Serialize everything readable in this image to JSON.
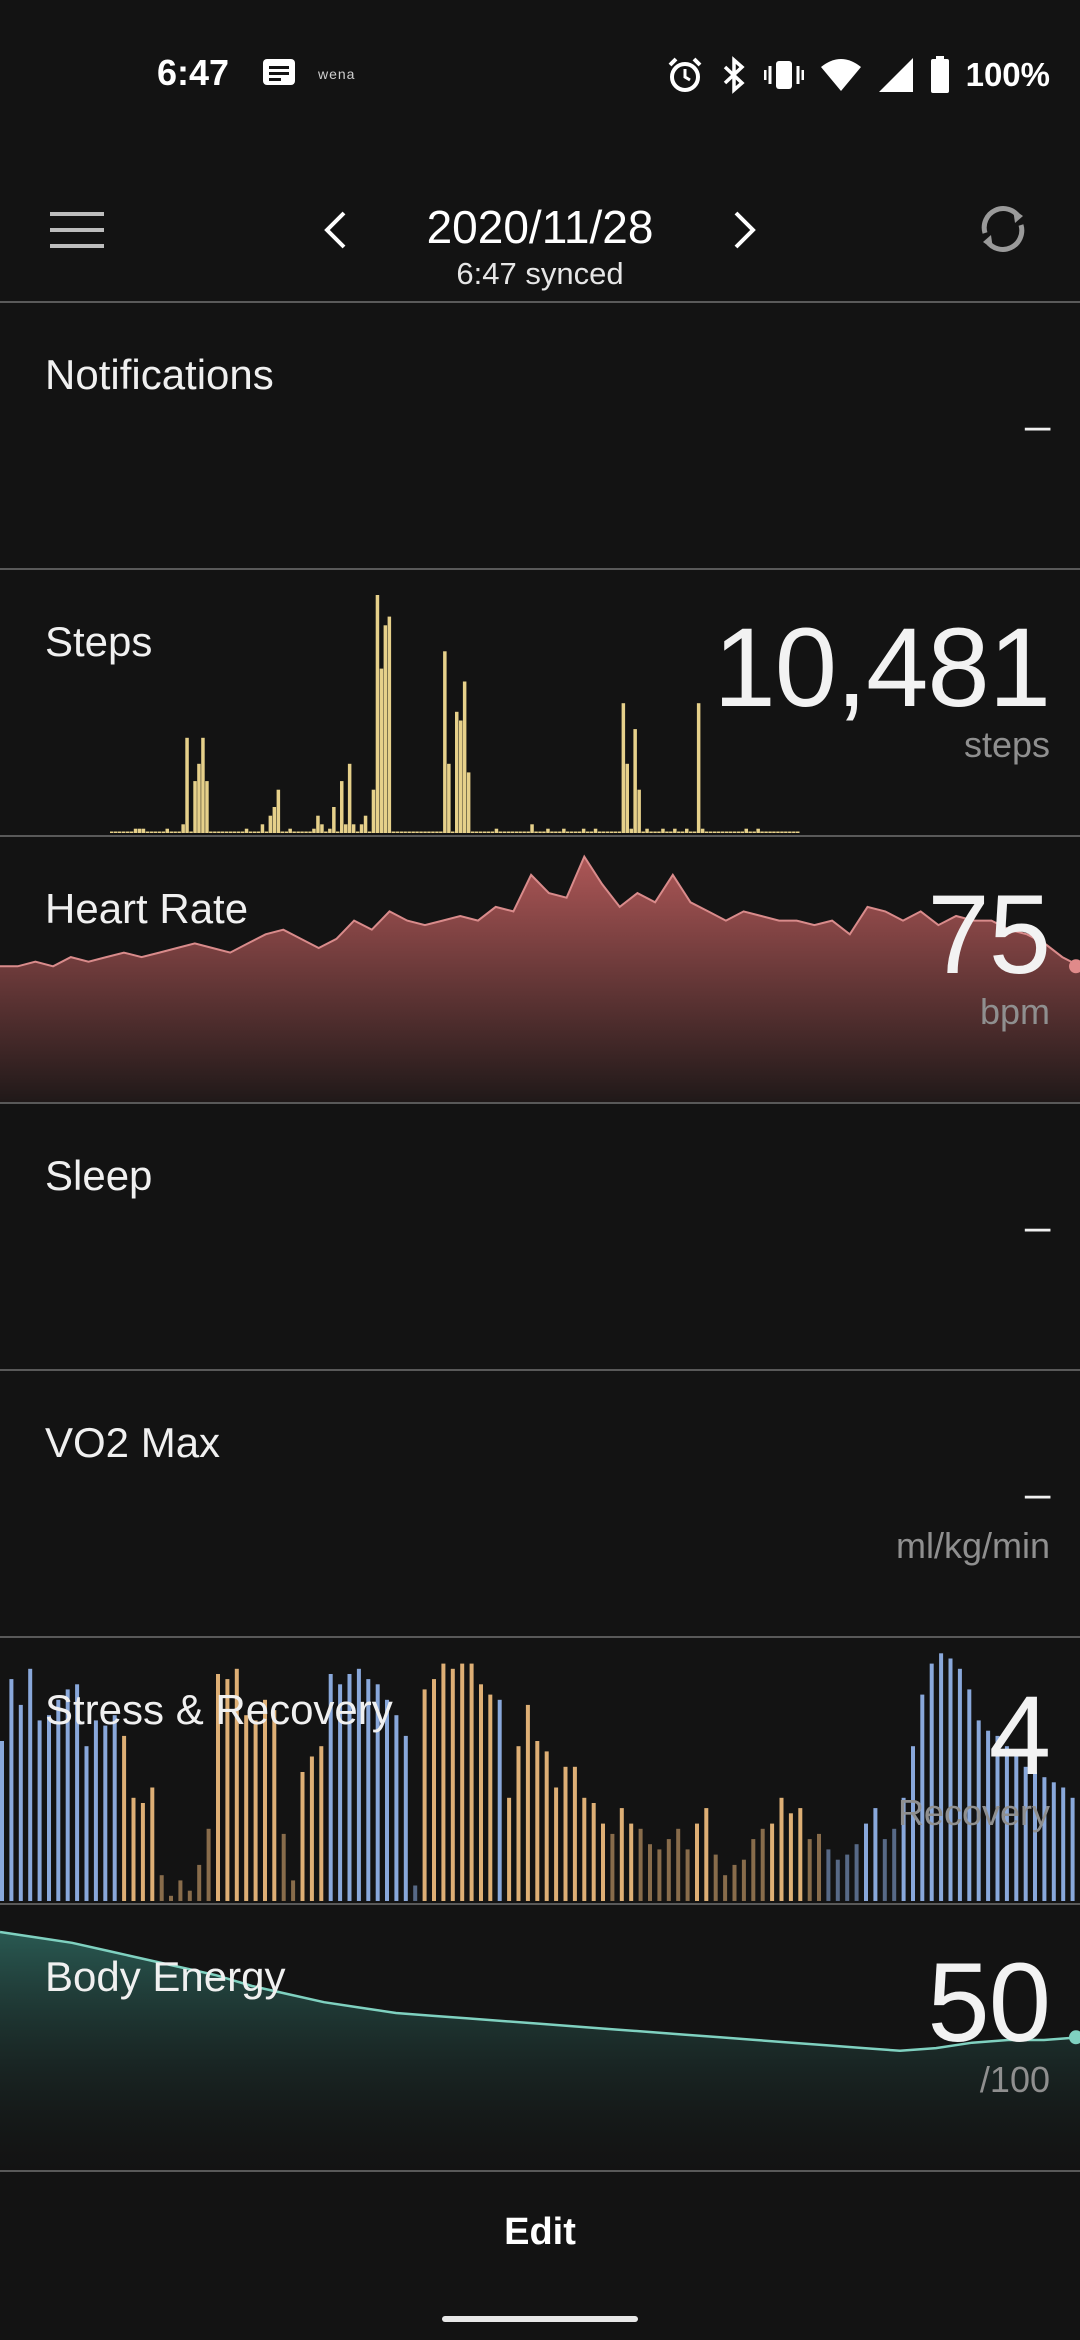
{
  "status_bar": {
    "time": "6:47",
    "app_label": "wena",
    "battery": "100%",
    "icons": [
      "message-icon",
      "alarm-icon",
      "bluetooth-icon",
      "vibrate-icon",
      "wifi-icon",
      "signal-icon",
      "battery-icon"
    ]
  },
  "header": {
    "date": "2020/11/28",
    "synced": "6:47 synced",
    "icons": [
      "menu-icon",
      "chevron-left-icon",
      "chevron-right-icon",
      "sync-icon"
    ]
  },
  "cards": {
    "notifications": {
      "title": "Notifications",
      "value": "_"
    },
    "steps": {
      "title": "Steps",
      "value": "10,481",
      "unit": "steps"
    },
    "heart_rate": {
      "title": "Heart Rate",
      "value": "75",
      "unit": "bpm"
    },
    "sleep": {
      "title": "Sleep",
      "value": "_"
    },
    "vo2max": {
      "title": "VO2 Max",
      "value": "_",
      "unit": "ml/kg/min"
    },
    "stress": {
      "title": "Stress & Recovery",
      "value": "4",
      "unit": "Recovery"
    },
    "body_energy": {
      "title": "Body Energy",
      "value": "50",
      "unit": "/100"
    }
  },
  "footer": {
    "edit_label": "Edit"
  },
  "colors": {
    "background": "#131313",
    "steps_bar": "#e6d08a",
    "heart_rate": "#b55a5a",
    "stress_blue": "#8fb0e6",
    "recovery_orange": "#e9b77a",
    "body_energy": "#7fd1c0"
  },
  "chart_data": [
    {
      "type": "bar",
      "name": "steps",
      "xlabel": "",
      "ylabel": "",
      "values": [
        0,
        0,
        0,
        0,
        0,
        0,
        1,
        1,
        1,
        0,
        0,
        0,
        0,
        0,
        1,
        0,
        0,
        0,
        2,
        22,
        0,
        12,
        16,
        22,
        12,
        0,
        0,
        0,
        0,
        0,
        0,
        0,
        0,
        0,
        1,
        0,
        0,
        0,
        2,
        0,
        4,
        6,
        10,
        0,
        0,
        1,
        0,
        0,
        0,
        0,
        0,
        1,
        4,
        2,
        0,
        1,
        6,
        0,
        12,
        2,
        16,
        2,
        0,
        2,
        4,
        0,
        10,
        55,
        38,
        48,
        50,
        0,
        0,
        0,
        0,
        0,
        0,
        0,
        0,
        0,
        0,
        0,
        0,
        0,
        42,
        16,
        0,
        28,
        26,
        35,
        14,
        0,
        0,
        0,
        0,
        0,
        0,
        1,
        0,
        0,
        0,
        0,
        0,
        0,
        0,
        0,
        2,
        0,
        0,
        0,
        1,
        0,
        0,
        0,
        1,
        0,
        0,
        0,
        0,
        1,
        0,
        0,
        1,
        0,
        0,
        0,
        0,
        0,
        0,
        30,
        16,
        1,
        24,
        10,
        0,
        1,
        0,
        0,
        0,
        1,
        0,
        0,
        1,
        0,
        0,
        1,
        0,
        0,
        30,
        1,
        0,
        0,
        0,
        0,
        0,
        0,
        0,
        0,
        0,
        0,
        1,
        0,
        0,
        1,
        0,
        0,
        0,
        0,
        0,
        0,
        0,
        0,
        0,
        0
      ]
    },
    {
      "type": "area",
      "name": "heart_rate",
      "xlabel": "",
      "ylabel": "",
      "values": [
        70,
        70,
        71,
        70,
        72,
        71,
        72,
        73,
        72,
        73,
        74,
        75,
        74,
        73,
        75,
        77,
        78,
        76,
        74,
        76,
        80,
        78,
        82,
        80,
        79,
        80,
        81,
        80,
        83,
        82,
        90,
        86,
        85,
        94,
        88,
        83,
        86,
        84,
        90,
        84,
        82,
        80,
        82,
        81,
        80,
        80,
        79,
        80,
        77,
        83,
        82,
        80,
        82,
        79,
        81,
        80,
        80,
        78,
        77,
        75,
        72,
        70
      ]
    },
    {
      "type": "bar",
      "name": "stress_and_recovery",
      "xlabel": "",
      "ylabel": "",
      "series": [
        {
          "name": "stress",
          "values": [
            62,
            86,
            76,
            90,
            70,
            72,
            78,
            82,
            84,
            60,
            70,
            68,
            72,
            64,
            40,
            38,
            44,
            10,
            2,
            8,
            4,
            14,
            28,
            88,
            86,
            90,
            72,
            70,
            78,
            74,
            26,
            8,
            50,
            56,
            60,
            88,
            84,
            88,
            90,
            86,
            84,
            78,
            72,
            64,
            6,
            82,
            86,
            92,
            90,
            92,
            92,
            84,
            80,
            78,
            40,
            60,
            76,
            62,
            58,
            44,
            52,
            52,
            40,
            38,
            30,
            26,
            36,
            30,
            28,
            22,
            20,
            24,
            28,
            20,
            30,
            36,
            18,
            10,
            14,
            16,
            24,
            28,
            30,
            40,
            34,
            36,
            24,
            26,
            20,
            16,
            18,
            22,
            30,
            36,
            24,
            28,
            40,
            60,
            80,
            92,
            96,
            94,
            90,
            82,
            70,
            66,
            64,
            60,
            58,
            52,
            50,
            48,
            46,
            44,
            40
          ]
        },
        {
          "name": "recovery",
          "values": [
            0,
            0,
            0,
            0,
            0,
            0,
            0,
            0,
            0,
            0,
            0,
            0,
            0,
            0,
            0,
            0,
            0,
            0,
            0,
            0,
            0,
            0,
            0,
            0,
            0,
            0,
            0,
            0,
            0,
            0,
            0,
            0,
            0,
            0,
            0,
            0,
            0,
            0,
            0,
            0,
            0,
            0,
            0,
            0,
            0,
            0,
            0,
            0,
            0,
            0,
            0,
            0,
            0,
            0,
            0,
            0,
            0,
            0,
            0,
            0,
            0,
            0,
            0,
            0,
            0,
            0,
            0,
            0,
            0,
            0,
            0,
            0,
            0,
            0,
            0,
            0,
            0,
            0,
            0,
            0,
            0,
            0,
            0,
            0,
            0,
            0,
            0,
            0,
            0,
            0,
            0,
            0,
            0,
            0,
            0,
            0,
            0,
            0,
            0,
            0,
            0,
            0,
            0,
            0,
            0,
            0,
            0,
            0,
            0,
            0,
            0,
            0,
            0,
            0,
            0
          ]
        }
      ]
    },
    {
      "type": "area",
      "name": "body_energy",
      "xlabel": "",
      "ylabel": "",
      "values": [
        90,
        88,
        86,
        83,
        80,
        77,
        74,
        70,
        67,
        64,
        62,
        60,
        59,
        58,
        57,
        56,
        55,
        54,
        53,
        52,
        51,
        50,
        49,
        48,
        47,
        46,
        47,
        49,
        50,
        50,
        51
      ]
    }
  ]
}
